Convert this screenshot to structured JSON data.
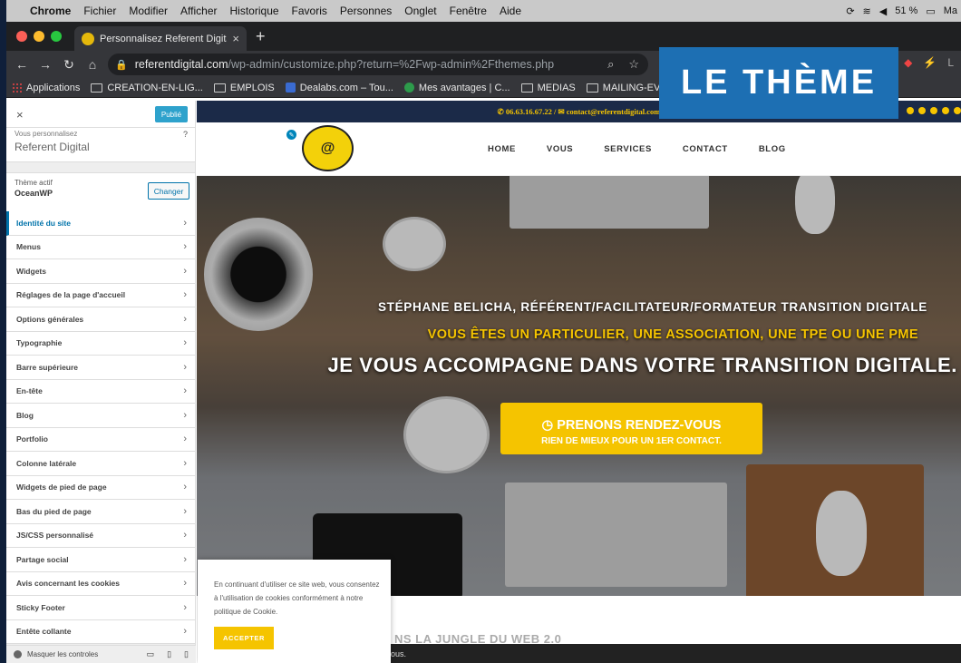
{
  "menubar": {
    "items": [
      "Chrome",
      "Fichier",
      "Modifier",
      "Afficher",
      "Historique",
      "Favoris",
      "Personnes",
      "Onglet",
      "Fenêtre",
      "Aide"
    ],
    "battery": "51 %",
    "clock": "Ma"
  },
  "tab": {
    "title": "Personnalisez Referent Digital –",
    "close": "×",
    "new_tab": "+"
  },
  "address": {
    "host": "referentdigital.com",
    "path": "/wp-admin/customize.php?return=%2Fwp-admin%2Fthemes.php"
  },
  "bookmarks": [
    "Applications",
    "CREATION-EN-LIG...",
    "EMPLOIS",
    "Dealabs.com – Tou...",
    "Mes avantages | C...",
    "MEDIAS",
    "MAILING-EVENEM..."
  ],
  "customizer": {
    "close": "×",
    "publish": "Publié",
    "customizing_label": "Vous personnalisez",
    "site_name": "Referent Digital",
    "help": "?",
    "active_theme_label": "Thème actif",
    "active_theme": "OceanWP",
    "change": "Changer",
    "menu": [
      "Identité du site",
      "Menus",
      "Widgets",
      "Réglages de la page d'accueil",
      "Options générales",
      "Typographie",
      "Barre supérieure",
      "En-tête",
      "Blog",
      "Portfolio",
      "Colonne latérale",
      "Widgets de pied de page",
      "Bas du pied de page",
      "JS/CSS personnalisé",
      "Partage social",
      "Avis concernant les cookies",
      "Sticky Footer",
      "Entête collante"
    ],
    "hide_controls": "Masquer les controles"
  },
  "site": {
    "topbar": "✆ 06.63.16.67.22 / ✉ contact@referentdigital.com",
    "nav": [
      "HOME",
      "VOUS",
      "SERVICES",
      "CONTACT",
      "BLOG"
    ],
    "hero_line1": "STÉPHANE BELICHA, RÉFÉRENT/FACILITATEUR/FORMATEUR TRANSITION DIGITALE",
    "hero_line2": "VOUS ÊTES UN PARTICULIER, UNE ASSOCIATION, UNE TPE OU UNE PME",
    "hero_line3": "JE VOUS ACCOMPAGNE DANS VOTRE TRANSITION DIGITALE.",
    "cta_title": "◷ PRENONS RENDEZ-VOUS",
    "cta_sub": "RIEN DE MIEUX POUR UN 1ER CONTACT.",
    "cookie_text": "En continuant d'utiliser ce site web, vous consentez à l'utilisation de cookies conformément à notre politique de Cookie.",
    "cookie_accept": "ACCEPTER",
    "below_text": "NS LA JUNGLE DU WEB 2.0",
    "dark_text": "ous."
  },
  "overlay_title": "LE THÈME",
  "colors": {
    "accent": "#f5c400",
    "topbar": "#1b2a48",
    "overlay": "#1d6fb3",
    "wp_blue": "#0073aa"
  }
}
